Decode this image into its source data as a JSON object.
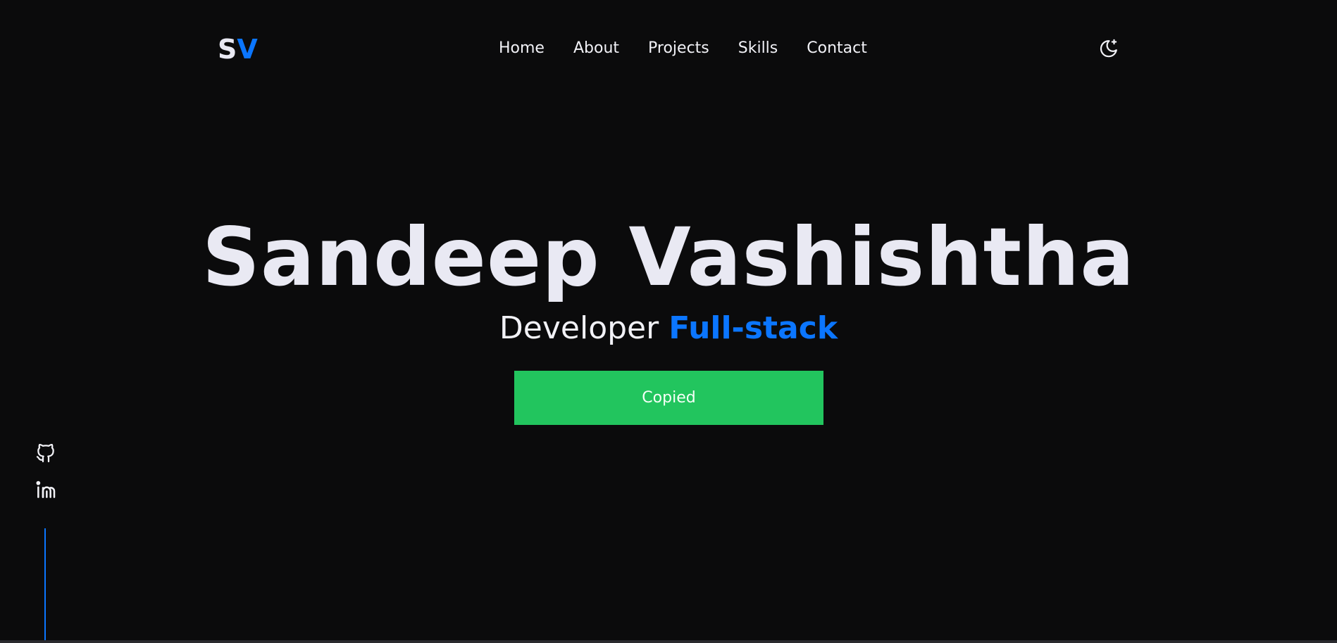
{
  "logo": {
    "part1": "S",
    "part2": "V"
  },
  "nav": {
    "items": [
      {
        "label": "Home"
      },
      {
        "label": "About"
      },
      {
        "label": "Projects"
      },
      {
        "label": "Skills"
      },
      {
        "label": "Contact"
      }
    ]
  },
  "theme_toggle": {
    "icon": "moon-sparkle-icon"
  },
  "hero": {
    "name": "Sandeep Vashishtha",
    "role_prefix": "Developer",
    "role_highlight": "Full-stack",
    "button_label": "Copied"
  },
  "social": {
    "items": [
      {
        "icon": "github-icon"
      },
      {
        "icon": "linkedin-icon"
      }
    ]
  },
  "colors": {
    "background": "#0b0b0c",
    "text": "#e9e9f3",
    "accent": "#0b76ff",
    "success": "#22c55e"
  }
}
